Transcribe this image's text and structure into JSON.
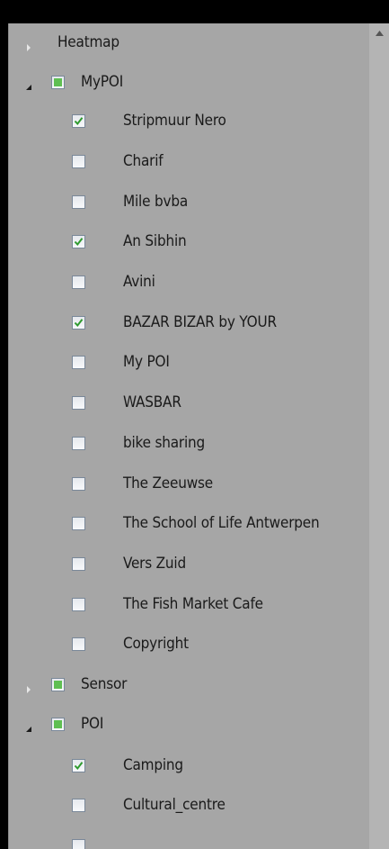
{
  "tree": [
    {
      "id": "heatmap",
      "label": "Heatmap",
      "level": 0,
      "expander": "collapsed",
      "checkbox": "none"
    },
    {
      "id": "mypoi",
      "label": "MyPOI",
      "level": 0,
      "expander": "expanded",
      "checkbox": "partial"
    },
    {
      "id": "stripmuur-nero",
      "label": "Stripmuur Nero",
      "level": 1,
      "checkbox": "checked"
    },
    {
      "id": "charif",
      "label": "Charif",
      "level": 1,
      "checkbox": "unchecked"
    },
    {
      "id": "mile-bvba",
      "label": "Mile bvba",
      "level": 1,
      "checkbox": "unchecked"
    },
    {
      "id": "an-sibhin",
      "label": "An Sibhin",
      "level": 1,
      "checkbox": "checked"
    },
    {
      "id": "avini",
      "label": "Avini",
      "level": 1,
      "checkbox": "unchecked"
    },
    {
      "id": "bazar-bizar",
      "label": "BAZAR BIZAR by YOUR",
      "level": 1,
      "checkbox": "checked"
    },
    {
      "id": "my-poi",
      "label": "My POI",
      "level": 1,
      "checkbox": "unchecked"
    },
    {
      "id": "wasbar",
      "label": "WASBAR",
      "level": 1,
      "checkbox": "unchecked"
    },
    {
      "id": "bike-sharing",
      "label": "bike sharing",
      "level": 1,
      "checkbox": "unchecked"
    },
    {
      "id": "the-zeeuwse",
      "label": "The Zeeuwse",
      "level": 1,
      "checkbox": "unchecked"
    },
    {
      "id": "school-of-life",
      "label": "The School of Life Antwerpen",
      "level": 1,
      "checkbox": "unchecked"
    },
    {
      "id": "vers-zuid",
      "label": "Vers Zuid",
      "level": 1,
      "checkbox": "unchecked"
    },
    {
      "id": "fish-market-cafe",
      "label": "The Fish Market Cafe",
      "level": 1,
      "checkbox": "unchecked"
    },
    {
      "id": "copyright",
      "label": "Copyright",
      "level": 1,
      "checkbox": "unchecked"
    },
    {
      "id": "sensor",
      "label": "Sensor",
      "level": 0,
      "expander": "collapsed",
      "checkbox": "partial"
    },
    {
      "id": "poi",
      "label": "POI",
      "level": 0,
      "expander": "expanded",
      "checkbox": "partial"
    },
    {
      "id": "camping",
      "label": "Camping",
      "level": 1,
      "checkbox": "checked"
    },
    {
      "id": "cultural-centre",
      "label": "Cultural_centre",
      "level": 1,
      "checkbox": "unchecked"
    },
    {
      "id": "next-item",
      "label": "",
      "level": 1,
      "checkbox": "unchecked"
    }
  ],
  "colors": {
    "panel": "#a6a6a6",
    "partial_fill": "#5fbf52",
    "check_mark": "#2e9a2e",
    "expander": "#e8e8e8",
    "expander_open": "#1a1a1a"
  },
  "icons": {
    "collapsed": "triangle-right-icon",
    "expanded": "triangle-down-icon",
    "check": "check-icon",
    "scroll_up": "arrow-up-icon"
  }
}
